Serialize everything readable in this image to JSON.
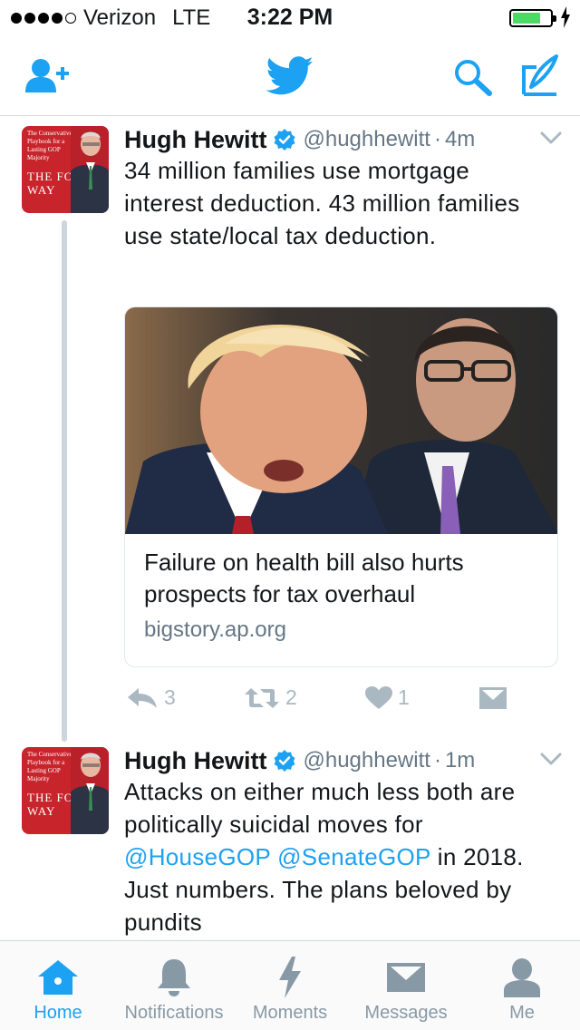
{
  "status_bar": {
    "carrier": "Verizon",
    "network": "LTE",
    "time": "3:22 PM",
    "battery_level": 0.75,
    "signal_bars_filled": 4,
    "signal_bars_total": 5
  },
  "nav": {
    "icons": [
      "add-user-icon",
      "twitter-bird-icon",
      "search-icon",
      "compose-icon"
    ],
    "accent_color": "#1da1f2"
  },
  "tweets": [
    {
      "author": "Hugh Hewitt",
      "handle": "@hughhewitt",
      "separator": "·",
      "time": "4m",
      "text": "34 million families use mortgage interest deduction. 43 million families use state/local tax deduction.",
      "card": {
        "title": "Failure on health bill also hurts prospects for tax overhaul",
        "domain": "bigstory.ap.org"
      },
      "replies": "3",
      "retweets": "2",
      "likes": "1"
    },
    {
      "author": "Hugh Hewitt",
      "handle": "@hughhewitt",
      "separator": "·",
      "time": "1m",
      "text_before": "Attacks on either much less both are politically suicidal moves for",
      "mention1": "@HouseGOP",
      "mention2": "@SenateGOP",
      "text_after": "in 2018. Just numbers. The plans beloved by pundits"
    }
  ],
  "avatar_cover": {
    "top_text": "The Conservative Playbook for a Lasting GOP Majority",
    "title": "THE FOURTH WAY"
  },
  "tabs": [
    {
      "label": "Home",
      "active": true
    },
    {
      "label": "Notifications",
      "active": false
    },
    {
      "label": "Moments",
      "active": false
    },
    {
      "label": "Messages",
      "active": false
    },
    {
      "label": "Me",
      "active": false
    }
  ]
}
